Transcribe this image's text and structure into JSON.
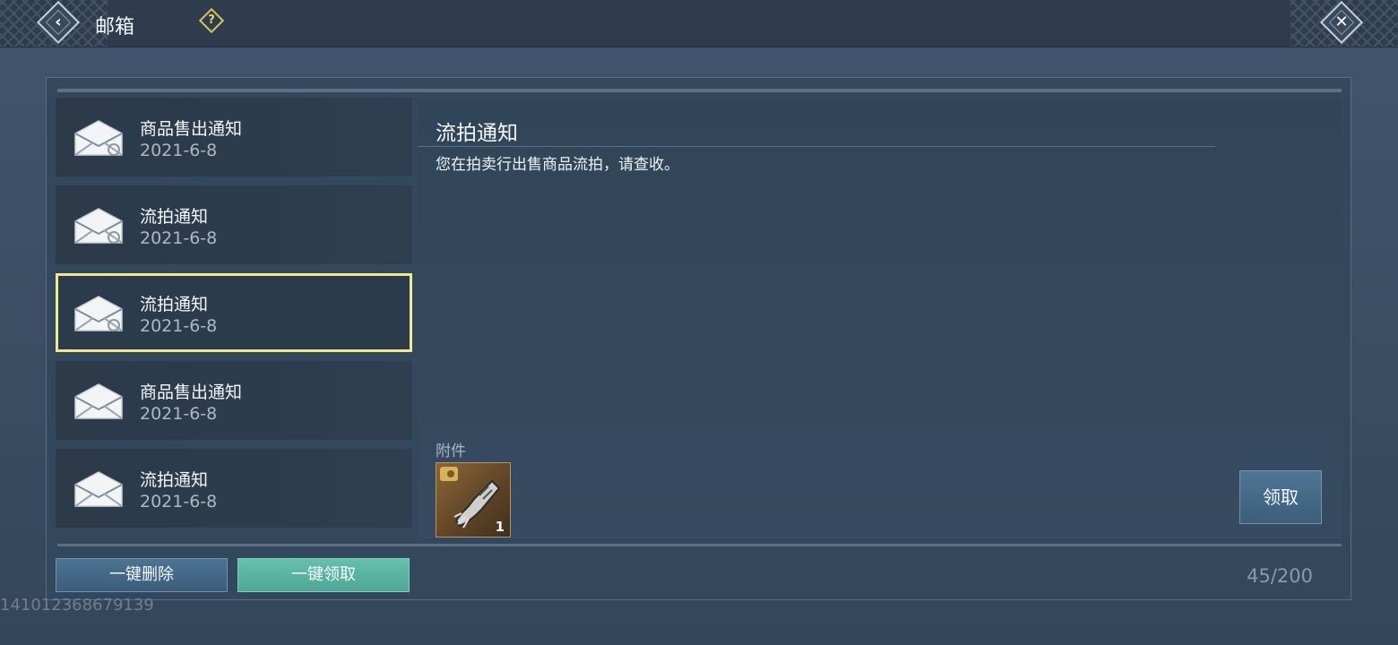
{
  "header": {
    "title": "邮箱",
    "back_glyph": "‹",
    "help_glyph": "?",
    "close_glyph": "✕"
  },
  "mail_list": [
    {
      "title": "商品售出通知",
      "date": "2021-6-8",
      "selected": false
    },
    {
      "title": "流拍通知",
      "date": "2021-6-8",
      "selected": false
    },
    {
      "title": "流拍通知",
      "date": "2021-6-8",
      "selected": true
    },
    {
      "title": "商品售出通知",
      "date": "2021-6-8",
      "selected": false
    },
    {
      "title": "流拍通知",
      "date": "2021-6-8",
      "selected": false
    }
  ],
  "detail": {
    "title": "流拍通知",
    "body": "您在拍卖行出售商品流拍，请查收。",
    "attachment_label": "附件",
    "attachment": {
      "icon": "gauntlet-item-icon",
      "count": "1"
    },
    "claim_label": "领取"
  },
  "footer": {
    "delete_all_label": "一键删除",
    "claim_all_label": "一键领取",
    "capacity": "45/200"
  },
  "uid": "141012368679139",
  "colors": {
    "selected_border": "#f0e88a",
    "claim_all": "#5bb4a2",
    "button_blue": "#456a88",
    "help_yellow": "#d6c75b"
  }
}
